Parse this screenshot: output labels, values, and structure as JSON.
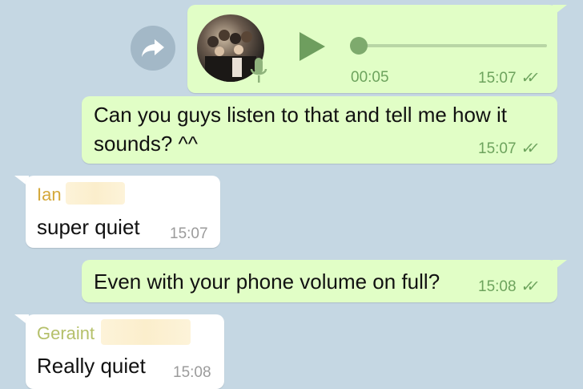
{
  "messages": [
    {
      "type": "voice",
      "direction": "out",
      "duration": "00:05",
      "time": "15:07",
      "status": "read"
    },
    {
      "type": "text",
      "direction": "out",
      "line1": "Can you guys listen to that and tell me how it",
      "line2": "sounds? ^^",
      "time": "15:07",
      "status": "read"
    },
    {
      "type": "text",
      "direction": "in",
      "sender": "Ian",
      "sender_color": "#d4a83a",
      "text": "super quiet",
      "time": "15:07"
    },
    {
      "type": "text",
      "direction": "out",
      "text": "Even with your phone volume on full?",
      "time": "15:08",
      "status": "read"
    },
    {
      "type": "text",
      "direction": "in",
      "sender": "Geraint",
      "sender_color": "#b5c06a",
      "text": "Really quiet",
      "time": "15:08"
    }
  ],
  "icons": {
    "share": "share-forward-icon",
    "play": "play-icon",
    "mic": "microphone-icon",
    "read": "double-check-icon"
  },
  "colors": {
    "background": "#c5d7e3",
    "outgoing_bubble": "#e1fec6",
    "incoming_bubble": "#ffffff",
    "outgoing_meta": "#6da35d"
  }
}
